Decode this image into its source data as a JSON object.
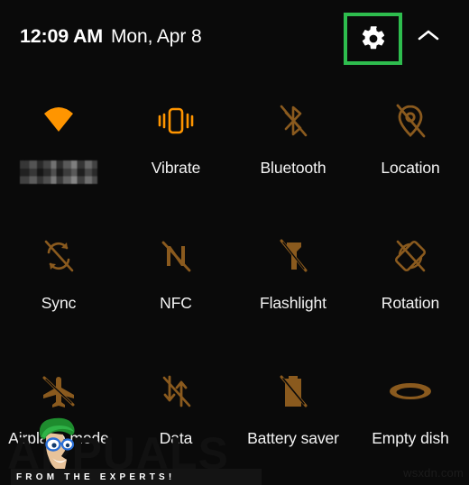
{
  "panel": {
    "background_color": "#0a0a0a",
    "active_icon_color": "#FF9500",
    "inactive_icon_color": "#8A5A1E",
    "label_color": "#F4F4F4",
    "highlight_color": "#2EBD4E"
  },
  "statusbar": {
    "time": "12:09 AM",
    "date": "Mon, Apr 8",
    "settings_icon": "gear-icon",
    "collapse_icon": "chevron-up-icon",
    "settings_highlighted": true
  },
  "tiles": [
    {
      "label": "",
      "icon": "wifi-icon",
      "state": "on",
      "redacted_label": true
    },
    {
      "label": "Vibrate",
      "icon": "vibrate-icon",
      "state": "on",
      "redacted_label": false
    },
    {
      "label": "Bluetooth",
      "icon": "bluetooth-off-icon",
      "state": "off",
      "redacted_label": false
    },
    {
      "label": "Location",
      "icon": "location-off-icon",
      "state": "off",
      "redacted_label": false
    },
    {
      "label": "Sync",
      "icon": "sync-off-icon",
      "state": "off",
      "redacted_label": false
    },
    {
      "label": "NFC",
      "icon": "nfc-off-icon",
      "state": "off",
      "redacted_label": false
    },
    {
      "label": "Flashlight",
      "icon": "flashlight-off-icon",
      "state": "off",
      "redacted_label": false
    },
    {
      "label": "Rotation",
      "icon": "rotation-off-icon",
      "state": "off",
      "redacted_label": false
    },
    {
      "label": "Airplane mode",
      "icon": "airplane-off-icon",
      "state": "off",
      "redacted_label": false
    },
    {
      "label": "Data",
      "icon": "mobile-data-off-icon",
      "state": "off",
      "redacted_label": false
    },
    {
      "label": "Battery saver",
      "icon": "battery-saver-off-icon",
      "state": "off",
      "redacted_label": false
    },
    {
      "label": "Empty dish",
      "icon": "dish-icon",
      "state": "off",
      "redacted_label": false
    }
  ],
  "watermark": {
    "brand": "APPUALS",
    "tagline": "FROM THE EXPERTS!",
    "mascot": "appuals-mascot-icon"
  },
  "site_credit": "wsxdn.com"
}
